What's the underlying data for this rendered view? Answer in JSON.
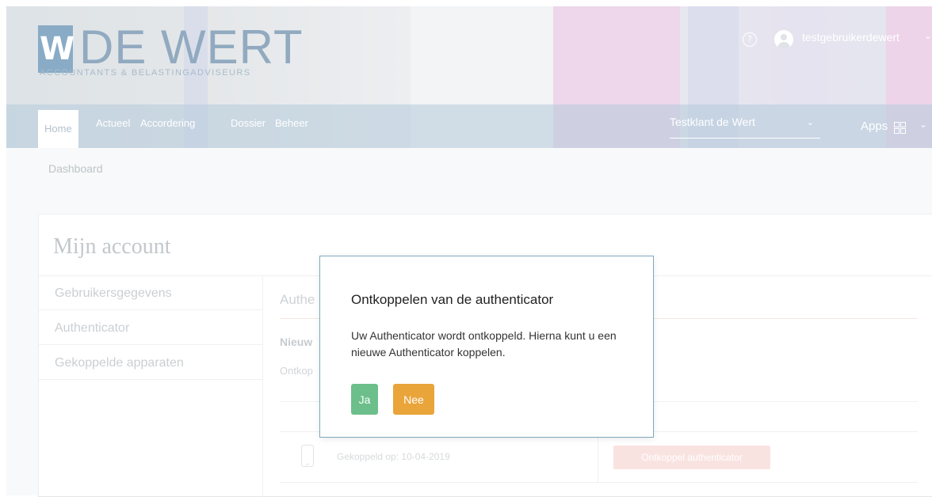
{
  "header": {
    "logo_mark": "W",
    "logo_title": "DE WERT",
    "logo_subtitle": "ACCOUNTANTS & BELASTINGADVISEURS",
    "user_name": "testgebruikerdewert"
  },
  "nav": {
    "items": [
      {
        "label": "Home"
      },
      {
        "label": "Actueel"
      },
      {
        "label": "Accordering"
      },
      {
        "label": "Dossier"
      },
      {
        "label": "Beheer"
      }
    ],
    "client_select": "Testklant de Wert",
    "apps_label": "Apps"
  },
  "breadcrumb": "Dashboard",
  "account": {
    "title": "Mijn account",
    "sidebar": [
      {
        "label": "Gebruikersgegevens"
      },
      {
        "label": "Authenticator"
      },
      {
        "label": "Gekoppelde apparaten"
      }
    ],
    "section_title": "Authe",
    "new_label": "Nieuw",
    "ontkop_text": "Ontkop",
    "device_text": "Gekoppeld op: 10-04-2019",
    "ontkoppel_button": "Ontkoppel authenticator"
  },
  "modal": {
    "title": "Ontkoppelen van de authenticator",
    "body": "Uw Authenticator wordt ontkoppeld. Hierna kunt u een nieuwe Authenticator koppelen.",
    "yes_label": "Ja",
    "no_label": "Nee"
  },
  "colors": {
    "ja_button": "#6cbf8a",
    "nee_button": "#e9a43a",
    "ontkoppel_button": "#f6d5d2"
  }
}
